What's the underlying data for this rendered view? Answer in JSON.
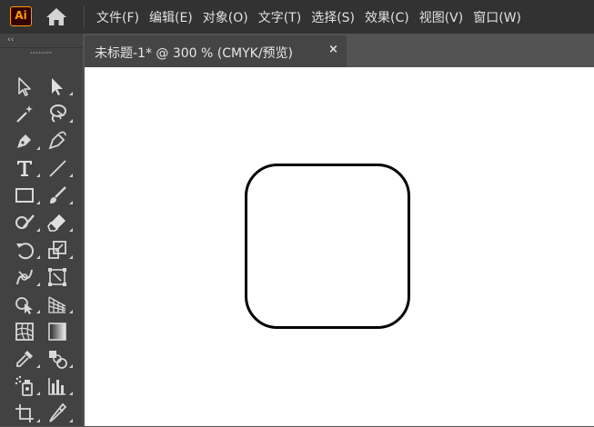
{
  "app": {
    "logo_text": "Ai",
    "logo_color": "#ff9a00",
    "home_icon": "home-icon"
  },
  "menu": [
    "文件(F)",
    "编辑(E)",
    "对象(O)",
    "文字(T)",
    "选择(S)",
    "效果(C)",
    "视图(V)",
    "窗口(W)"
  ],
  "toolbar": {
    "collapse_label": "‹‹",
    "tools": [
      [
        "selection-tool",
        "direct-selection-tool"
      ],
      [
        "magic-wand-tool",
        "lasso-tool"
      ],
      [
        "pen-tool",
        "curvature-tool"
      ],
      [
        "type-tool",
        "line-segment-tool"
      ],
      [
        "rectangle-tool",
        "paintbrush-tool"
      ],
      [
        "shaper-tool",
        "eraser-tool"
      ],
      [
        "rotate-tool",
        "scale-tool"
      ],
      [
        "puppet-warp-tool",
        "free-transform-tool"
      ],
      [
        "shape-builder-tool",
        "perspective-grid-tool"
      ],
      [
        "mesh-tool",
        "gradient-tool"
      ],
      [
        "eyedropper-tool",
        "blend-tool"
      ],
      [
        "symbol-sprayer-tool",
        "column-graph-tool"
      ],
      [
        "artboard-tool",
        "slice-tool"
      ]
    ]
  },
  "document": {
    "tab_title": "未标题-1* @ 300 % (CMYK/预览)",
    "close_label": "×"
  },
  "colors": {
    "menubar_bg": "#323232",
    "toolbar_bg": "#424242",
    "workspace_bg": "#535353",
    "canvas_bg": "#ffffff",
    "shape_stroke": "#000000"
  }
}
